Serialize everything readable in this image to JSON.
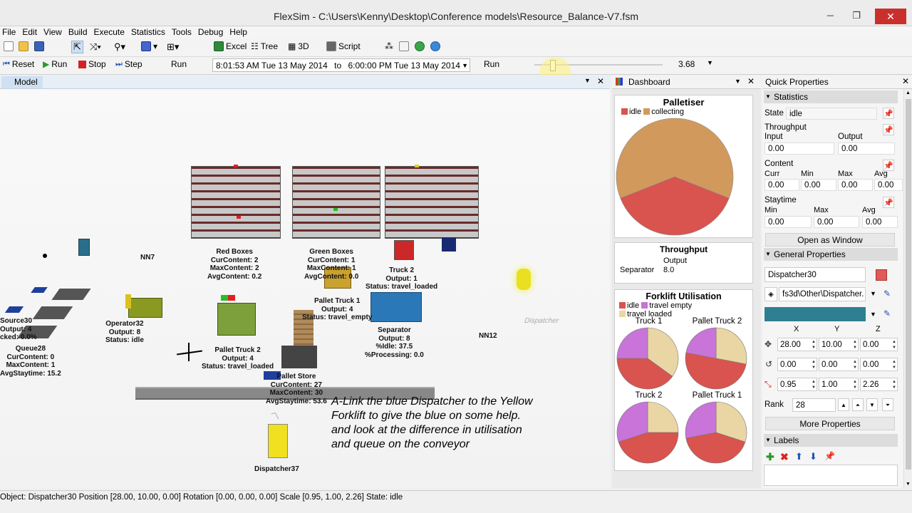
{
  "window": {
    "title": "FlexSim - C:\\Users\\Kenny\\Desktop\\Conference models\\Resource_Balance-V7.fsm",
    "minimize": "─",
    "maximize": "❐",
    "close": "✕"
  },
  "menu": [
    "File",
    "Edit",
    "View",
    "Build",
    "Execute",
    "Statistics",
    "Tools",
    "Debug",
    "Help"
  ],
  "toolbar1": {
    "excel": "Excel",
    "tree": "Tree",
    "view3d": "3D",
    "script": "Script"
  },
  "toolbar2": {
    "reset": "Reset",
    "run": "Run",
    "stop": "Stop",
    "step": "Step",
    "run_time_label": "Run",
    "start_time": "8:01:53 AM  Tue 13 May 2014",
    "to": "to",
    "end_time": "6:00:00 PM  Tue 13 May 2014",
    "run_speed_label": "Run",
    "speed_value": "3.68"
  },
  "model": {
    "tab": "Model",
    "labels": {
      "nn7": "NN7",
      "nn12": "NN12",
      "dispatcher_floor": "Dispatcher",
      "red_boxes": "Red Boxes\nCurContent: 2\nMaxContent: 2\nAvgContent: 0.2",
      "green_boxes": "Green Boxes\nCurContent: 1\nMaxContent: 1\nAvgContent: 0.0",
      "truck2": "Truck 2\nOutput: 1\nStatus: travel_loaded",
      "pallet_truck1": "Pallet Truck 1\nOutput: 4\nStatus: travel_empty",
      "source30": "Source30\nOutput: 4\ncked: 0.0%",
      "queue28": "Queue28\nCurContent: 0\nMaxContent: 1\nAvgStaytime: 15.2",
      "operator32": "Operator32\nOutput: 8\nStatus: idle",
      "pallet_truck2": "Pallet Truck 2\nOutput: 4\nStatus: travel_loaded",
      "separator": "Separator\nOutput: 8\n%Idle: 37.5\n%Processing: 0.0",
      "pallet_store": "Pallet Store\nCurContent: 27\nMaxContent: 30\nAvgStaytime: 53.6",
      "dispatcher37": "Dispatcher37"
    },
    "annotation": [
      "A-Link the blue Dispatcher to the Yellow",
      "Forklift to give the blue on some help.",
      "and look at the difference in utilisation",
      "and queue on the conveyor"
    ]
  },
  "dashboard": {
    "tab": "Dashboard",
    "palletiser": {
      "title": "Palletiser",
      "legend": [
        {
          "name": "idle",
          "color": "#d9534f"
        },
        {
          "name": "collecting",
          "color": "#d19a5c"
        }
      ],
      "idle_fraction": 0.38
    },
    "throughput": {
      "title": "Throughput",
      "column": "Output",
      "row_label": "Separator",
      "row_value": "8.0"
    },
    "forklift": {
      "title": "Forklift Utilisation",
      "legend": [
        {
          "name": "idle",
          "color": "#d9534f"
        },
        {
          "name": "travel empty",
          "color": "#c874d8"
        },
        {
          "name": "travel loaded",
          "color": "#e9d6a4"
        }
      ],
      "pies": [
        {
          "name": "Truck 1",
          "idle": 0.4,
          "empty": 0.25,
          "loaded": 0.35
        },
        {
          "name": "Pallet Truck 2",
          "idle": 0.5,
          "empty": 0.22,
          "loaded": 0.28
        },
        {
          "name": "Truck 2",
          "idle": 0.45,
          "empty": 0.3,
          "loaded": 0.25
        },
        {
          "name": "Pallet Truck 1",
          "idle": 0.42,
          "empty": 0.28,
          "loaded": 0.3
        }
      ]
    }
  },
  "quick_properties": {
    "tab": "Quick Properties",
    "statistics": {
      "header": "Statistics",
      "state_label": "State",
      "state_value": "idle",
      "throughput_label": "Throughput",
      "input_label": "Input",
      "output_label": "Output",
      "input_value": "0.00",
      "output_value": "0.00",
      "content_label": "Content",
      "curr_label": "Curr",
      "min_label": "Min",
      "max_label": "Max",
      "avg_label": "Avg",
      "curr": "0.00",
      "min": "0.00",
      "max": "0.00",
      "avg": "0.00",
      "staytime_label": "Staytime",
      "st_min": "0.00",
      "st_max": "0.00",
      "st_avg": "0.00",
      "open_window": "Open as Window"
    },
    "general": {
      "header": "General Properties",
      "name": "Dispatcher30",
      "shape": "fs3d\\Other\\Dispatcher.",
      "color": "#2e7f91",
      "x_label": "X",
      "y_label": "Y",
      "z_label": "Z",
      "pos": [
        "28.00",
        "10.00",
        "0.00"
      ],
      "rot": [
        "0.00",
        "0.00",
        "0.00"
      ],
      "scale": [
        "0.95",
        "1.00",
        "2.26"
      ],
      "rank_label": "Rank",
      "rank": "28",
      "more": "More Properties"
    },
    "labels_header": "Labels"
  },
  "status": "Object: Dispatcher30  Position [28.00, 10.00, 0.00]  Rotation [0.00, 0.00, 0.00]  Scale [0.95, 1.00, 2.26]  State: idle"
}
